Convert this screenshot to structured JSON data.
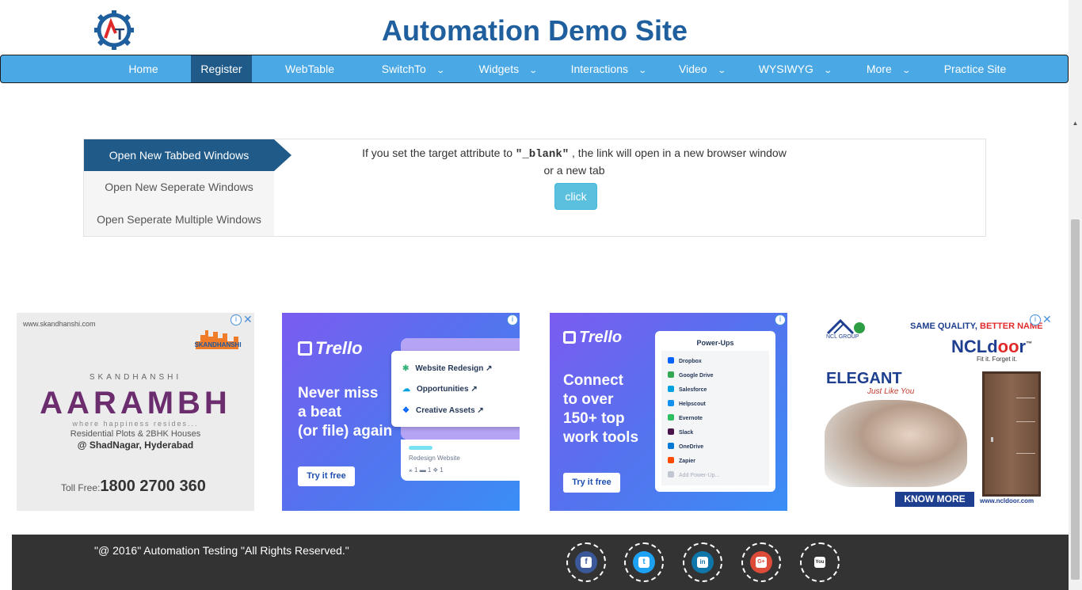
{
  "header": {
    "title": "Automation Demo Site",
    "logo_icon": "gear-logo-icon"
  },
  "nav": {
    "items": [
      {
        "label": "Home",
        "dropdown": false,
        "active": false
      },
      {
        "label": "Register",
        "dropdown": false,
        "active": true
      },
      {
        "label": "WebTable",
        "dropdown": false,
        "active": false
      },
      {
        "label": "SwitchTo",
        "dropdown": true,
        "active": false
      },
      {
        "label": "Widgets",
        "dropdown": true,
        "active": false
      },
      {
        "label": "Interactions",
        "dropdown": true,
        "active": false
      },
      {
        "label": "Video",
        "dropdown": true,
        "active": false
      },
      {
        "label": "WYSIWYG",
        "dropdown": true,
        "active": false
      },
      {
        "label": "More",
        "dropdown": true,
        "active": false
      },
      {
        "label": "Practice Site",
        "dropdown": false,
        "active": false
      }
    ],
    "chevron": "⌄"
  },
  "tabs": {
    "items": [
      {
        "label": "Open New Tabbed Windows",
        "active": true
      },
      {
        "label": "Open New Seperate Windows",
        "active": false
      },
      {
        "label": "Open Seperate Multiple Windows",
        "active": false
      }
    ],
    "content": {
      "text_before": "If you set the target attribute to ",
      "code": "\"_blank\"",
      "text_after": " , the link will open in a new browser window or a new tab",
      "button_label": "click"
    }
  },
  "ads": {
    "info": "i",
    "close": "✕",
    "ad1": {
      "url": "www.skandhanshi.com",
      "logo_text": "SKANDHANSHI",
      "brand_sub": "SKANDHANSHI",
      "brand": "AARAMBH",
      "tagline": "where happiness resides...",
      "line1": "Residential Plots & 2BHK Houses",
      "line2": "@ ShadNagar, Hyderabad",
      "toll_label": "Toll Free:",
      "toll_number": "1800 2700 360"
    },
    "ad2": {
      "logo": "Trello",
      "headline": [
        "Never miss",
        "a beat",
        "(or file) again"
      ],
      "rows": [
        "Website Redesign ↗",
        "Opportunities ↗",
        "Creative Assets ↗"
      ],
      "card_title": "Redesign Website",
      "card_meta": "⚹ 1   ▬ 1   ❖ 1",
      "cta": "Try it free"
    },
    "ad3": {
      "logo": "Trello",
      "headline": [
        "Connect",
        "to over",
        "150+ top",
        "work tools"
      ],
      "panel_title": "Power-Ups",
      "powerups": [
        {
          "name": "Dropbox",
          "color": "#0061ff"
        },
        {
          "name": "Google Drive",
          "color": "#34a853"
        },
        {
          "name": "Salesforce",
          "color": "#00a1e0"
        },
        {
          "name": "Helpscout",
          "color": "#1292ee"
        },
        {
          "name": "Evernote",
          "color": "#2dbe60"
        },
        {
          "name": "Slack",
          "color": "#4a154b"
        },
        {
          "name": "OneDrive",
          "color": "#0078d4"
        },
        {
          "name": "Zapier",
          "color": "#ff4a00"
        },
        {
          "name": "Add Power-Up...",
          "color": "#c1c7d0"
        }
      ],
      "cta": "Try it free"
    },
    "ad4": {
      "group": "NCL GROUP",
      "same": "SAME QUALITY, ",
      "better": "BETTER NAME",
      "brand_a": "NCLd",
      "brand_b": "oo",
      "brand_c": "r",
      "tm": "™",
      "fit": "Fit it. Forget it.",
      "elegant": "ELEGANT",
      "just": "Just Like You",
      "cta": "KNOW MORE",
      "web": "www.ncldoor.com"
    }
  },
  "footer": {
    "copyright": "\"@ 2016\" Automation Testing \"All Rights Reserved.\"",
    "social": [
      {
        "name": "facebook",
        "glyph": "f",
        "color": "#3b5998"
      },
      {
        "name": "twitter",
        "glyph": "t",
        "color": "#1da1f2"
      },
      {
        "name": "linkedin",
        "glyph": "in",
        "color": "#0e76a8"
      },
      {
        "name": "google-plus",
        "glyph": "G+",
        "color": "#dd4b39"
      },
      {
        "name": "youtube",
        "glyph": "You",
        "color": "#333333"
      }
    ]
  },
  "colors": {
    "nav_bg": "#4aa8e4",
    "nav_active": "#1f5a88",
    "title": "#1f5f9e",
    "button": "#5bc0de",
    "footer_bg": "#333333"
  }
}
